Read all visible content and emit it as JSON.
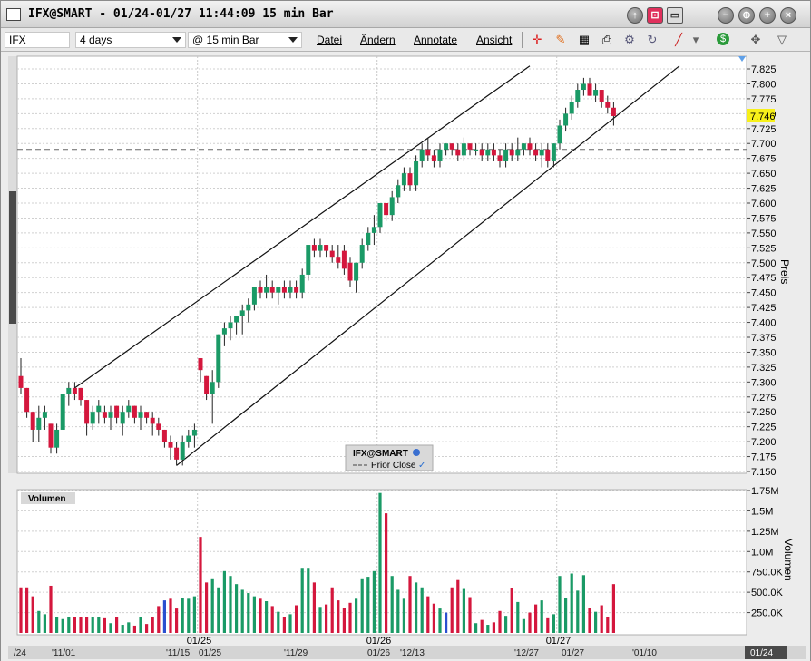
{
  "window": {
    "title": "IFX@SMART - 01/24-01/27 11:44:09 15 min Bar",
    "title_buttons": [
      "↑",
      "⊡",
      "▭",
      "−",
      "⊕",
      "+",
      "×"
    ]
  },
  "toolbar": {
    "symbol": "IFX",
    "duration": "4 days",
    "bar_size": "@ 15 min Bar",
    "menus": [
      "Datei",
      "Ändern",
      "Annotate",
      "Ansicht"
    ],
    "tools": [
      "crosshair-icon",
      "pencil-icon",
      "grid-icon",
      "print-icon",
      "settings-icon",
      "refresh-icon",
      "draw-line-icon",
      "dropdown-icon",
      "dollar-icon",
      "move-icon",
      "filter-icon"
    ]
  },
  "price_panel": {
    "axis_label": "Preis",
    "ticks": [
      "7.825",
      "7.800",
      "7.775",
      "7.750",
      "7.725",
      "7.700",
      "7.675",
      "7.650",
      "7.625",
      "7.600",
      "7.575",
      "7.550",
      "7.525",
      "7.500",
      "7.475",
      "7.450",
      "7.425",
      "7.400",
      "7.375",
      "7.350",
      "7.325",
      "7.300",
      "7.275",
      "7.250",
      "7.225",
      "7.200",
      "7.175",
      "7.150"
    ],
    "last_price": "7.746",
    "prior_close": 7.69,
    "legend_title": "IFX@SMART",
    "legend_item": "Prior Close",
    "date_labels": [
      "01/25",
      "01/26",
      "01/27"
    ],
    "colors": {
      "up": "#1a9a66",
      "down": "#d4173d",
      "last_bg": "#f7f01a"
    }
  },
  "volume_panel": {
    "title": "Volumen",
    "axis_label": "Volumen",
    "ticks": [
      "1.75M",
      "1.5M",
      "1.25M",
      "1.0M",
      "750.0K",
      "500.0K",
      "250.0K"
    ]
  },
  "timeline": {
    "labels": [
      "/24",
      "'11/01",
      "'11/15",
      "01/25",
      "'11/29",
      "01/26",
      "'12/13",
      "'12/27",
      "01/27",
      "'01/10",
      "01/24"
    ]
  },
  "chart_data": {
    "type": "candlestick",
    "ylim": [
      7.15,
      7.83
    ],
    "volume_ylim": [
      0,
      1750000
    ],
    "channel_lines": [
      {
        "from": [
          9,
          7.29
        ],
        "to": [
          85,
          7.83
        ]
      },
      {
        "from": [
          26,
          7.16
        ],
        "to": [
          110,
          7.83
        ]
      }
    ],
    "bars": [
      [
        7.31,
        7.34,
        7.28,
        7.29,
        560000
      ],
      [
        7.29,
        7.29,
        7.24,
        7.25,
        560000
      ],
      [
        7.25,
        7.25,
        7.2,
        7.22,
        450000
      ],
      [
        7.22,
        7.26,
        7.2,
        7.24,
        270000
      ],
      [
        7.24,
        7.26,
        7.22,
        7.25,
        230000
      ],
      [
        7.23,
        7.23,
        7.18,
        7.19,
        580000
      ],
      [
        7.19,
        7.23,
        7.18,
        7.22,
        200000
      ],
      [
        7.22,
        7.28,
        7.22,
        7.28,
        170000
      ],
      [
        7.28,
        7.3,
        7.26,
        7.29,
        200000
      ],
      [
        7.29,
        7.3,
        7.27,
        7.28,
        190000
      ],
      [
        7.29,
        7.29,
        7.26,
        7.27,
        200000
      ],
      [
        7.27,
        7.27,
        7.21,
        7.23,
        190000
      ],
      [
        7.23,
        7.26,
        7.22,
        7.25,
        190000
      ],
      [
        7.25,
        7.27,
        7.23,
        7.26,
        190000
      ],
      [
        7.25,
        7.26,
        7.23,
        7.24,
        180000
      ],
      [
        7.24,
        7.26,
        7.22,
        7.25,
        120000
      ],
      [
        7.26,
        7.26,
        7.23,
        7.24,
        190000
      ],
      [
        7.23,
        7.26,
        7.21,
        7.25,
        100000
      ],
      [
        7.25,
        7.27,
        7.24,
        7.26,
        130000
      ],
      [
        7.26,
        7.26,
        7.23,
        7.24,
        90000
      ],
      [
        7.24,
        7.26,
        7.22,
        7.25,
        200000
      ],
      [
        7.25,
        7.25,
        7.23,
        7.24,
        110000
      ],
      [
        7.24,
        7.25,
        7.21,
        7.23,
        200000
      ],
      [
        7.23,
        7.24,
        7.21,
        7.22,
        330000
      ],
      [
        7.22,
        7.22,
        7.19,
        7.2,
        400000
      ],
      [
        7.2,
        7.21,
        7.17,
        7.19,
        420000
      ],
      [
        7.19,
        7.2,
        7.16,
        7.17,
        300000
      ],
      [
        7.17,
        7.21,
        7.16,
        7.2,
        430000
      ],
      [
        7.2,
        7.22,
        7.19,
        7.21,
        420000
      ],
      [
        7.21,
        7.23,
        7.19,
        7.22,
        450000
      ],
      [
        7.34,
        7.34,
        7.3,
        7.32,
        1180000
      ],
      [
        7.31,
        7.31,
        7.27,
        7.28,
        620000
      ],
      [
        7.28,
        7.32,
        7.23,
        7.3,
        660000
      ],
      [
        7.3,
        7.38,
        7.29,
        7.38,
        560000
      ],
      [
        7.38,
        7.4,
        7.36,
        7.39,
        760000
      ],
      [
        7.39,
        7.41,
        7.37,
        7.4,
        700000
      ],
      [
        7.4,
        7.41,
        7.38,
        7.41,
        600000
      ],
      [
        7.41,
        7.43,
        7.38,
        7.42,
        530000
      ],
      [
        7.42,
        7.44,
        7.4,
        7.43,
        490000
      ],
      [
        7.43,
        7.46,
        7.42,
        7.46,
        450000
      ],
      [
        7.46,
        7.47,
        7.44,
        7.45,
        420000
      ],
      [
        7.45,
        7.48,
        7.44,
        7.46,
        390000
      ],
      [
        7.46,
        7.47,
        7.44,
        7.45,
        330000
      ],
      [
        7.45,
        7.46,
        7.43,
        7.46,
        260000
      ],
      [
        7.46,
        7.47,
        7.44,
        7.45,
        200000
      ],
      [
        7.45,
        7.47,
        7.44,
        7.46,
        230000
      ],
      [
        7.46,
        7.47,
        7.44,
        7.45,
        340000
      ],
      [
        7.45,
        7.49,
        7.44,
        7.48,
        800000
      ],
      [
        7.48,
        7.53,
        7.47,
        7.53,
        800000
      ],
      [
        7.53,
        7.54,
        7.51,
        7.52,
        620000
      ],
      [
        7.52,
        7.54,
        7.51,
        7.53,
        320000
      ],
      [
        7.53,
        7.53,
        7.51,
        7.52,
        350000
      ],
      [
        7.52,
        7.53,
        7.5,
        7.51,
        560000
      ],
      [
        7.51,
        7.53,
        7.49,
        7.5,
        400000
      ],
      [
        7.52,
        7.53,
        7.48,
        7.49,
        310000
      ],
      [
        7.5,
        7.51,
        7.46,
        7.47,
        370000
      ],
      [
        7.47,
        7.5,
        7.45,
        7.5,
        420000
      ],
      [
        7.5,
        7.54,
        7.49,
        7.53,
        660000
      ],
      [
        7.53,
        7.56,
        7.52,
        7.55,
        690000
      ],
      [
        7.55,
        7.58,
        7.53,
        7.56,
        760000
      ],
      [
        7.56,
        7.6,
        7.55,
        7.6,
        1720000
      ],
      [
        7.6,
        7.6,
        7.57,
        7.58,
        1470000
      ],
      [
        7.58,
        7.62,
        7.57,
        7.61,
        700000
      ],
      [
        7.61,
        7.64,
        7.6,
        7.63,
        530000
      ],
      [
        7.63,
        7.66,
        7.62,
        7.65,
        420000
      ],
      [
        7.65,
        7.66,
        7.62,
        7.63,
        700000
      ],
      [
        7.63,
        7.68,
        7.62,
        7.67,
        620000
      ],
      [
        7.67,
        7.7,
        7.66,
        7.69,
        560000
      ],
      [
        7.69,
        7.71,
        7.67,
        7.68,
        450000
      ],
      [
        7.68,
        7.69,
        7.66,
        7.67,
        360000
      ],
      [
        7.67,
        7.7,
        7.66,
        7.69,
        300000
      ],
      [
        7.69,
        7.7,
        7.68,
        7.7,
        250000
      ],
      [
        7.7,
        7.7,
        7.68,
        7.69,
        560000
      ],
      [
        7.69,
        7.7,
        7.67,
        7.68,
        650000
      ],
      [
        7.68,
        7.71,
        7.67,
        7.7,
        540000
      ],
      [
        7.7,
        7.7,
        7.68,
        7.69,
        440000
      ],
      [
        7.69,
        7.7,
        7.68,
        7.69,
        120000
      ],
      [
        7.69,
        7.7,
        7.67,
        7.68,
        160000
      ],
      [
        7.68,
        7.7,
        7.67,
        7.69,
        100000
      ],
      [
        7.69,
        7.7,
        7.67,
        7.68,
        130000
      ],
      [
        7.68,
        7.69,
        7.66,
        7.67,
        270000
      ],
      [
        7.67,
        7.7,
        7.66,
        7.69,
        210000
      ],
      [
        7.69,
        7.7,
        7.67,
        7.68,
        550000
      ],
      [
        7.68,
        7.71,
        7.67,
        7.69,
        380000
      ],
      [
        7.69,
        7.7,
        7.68,
        7.7,
        170000
      ],
      [
        7.7,
        7.71,
        7.68,
        7.69,
        250000
      ],
      [
        7.69,
        7.7,
        7.67,
        7.68,
        350000
      ],
      [
        7.68,
        7.7,
        7.66,
        7.69,
        400000
      ],
      [
        7.69,
        7.7,
        7.66,
        7.67,
        180000
      ],
      [
        7.67,
        7.7,
        7.66,
        7.7,
        230000
      ],
      [
        7.7,
        7.74,
        7.69,
        7.73,
        700000
      ],
      [
        7.73,
        7.76,
        7.72,
        7.75,
        430000
      ],
      [
        7.75,
        7.78,
        7.74,
        7.77,
        730000
      ],
      [
        7.77,
        7.8,
        7.76,
        7.79,
        520000
      ],
      [
        7.79,
        7.81,
        7.78,
        7.8,
        710000
      ],
      [
        7.8,
        7.81,
        7.78,
        7.78,
        310000
      ],
      [
        7.78,
        7.8,
        7.77,
        7.79,
        260000
      ],
      [
        7.79,
        7.79,
        7.76,
        7.77,
        340000
      ],
      [
        7.77,
        7.78,
        7.75,
        7.76,
        200000
      ],
      [
        7.76,
        7.77,
        7.73,
        7.746,
        600000
      ]
    ],
    "blue_volume_bars": [
      24,
      71,
      106
    ]
  }
}
